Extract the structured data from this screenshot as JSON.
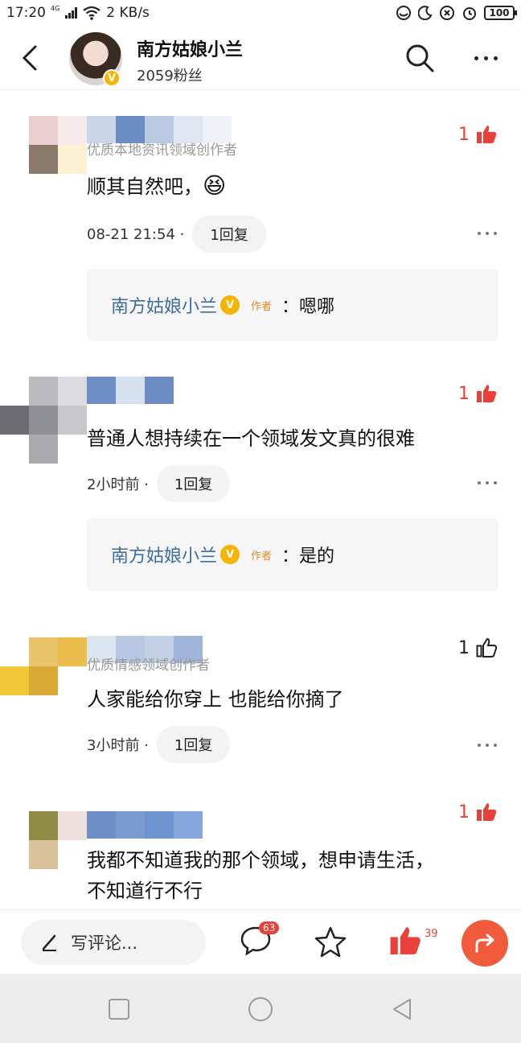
{
  "status_bar": {
    "time": "17:20",
    "network_tag": "4G",
    "speed": "2 KB/s",
    "battery": "100"
  },
  "header": {
    "name": "南方姑娘小兰",
    "fans": "2059粉丝",
    "verified_mark": "V"
  },
  "comments": [
    {
      "sub_label": "优质本地资讯领域创作者",
      "text": "顺其自然吧，",
      "emoji": "😆",
      "time": "08-21 21:54 ·",
      "reply_count": "1回复",
      "likes": "1",
      "liked": true,
      "reply": {
        "author": "南方姑娘小兰",
        "tag": "作者",
        "text": "：嗯哪"
      }
    },
    {
      "sub_label": "",
      "text": "普通人想持续在一个领域发文真的很难",
      "time": "2小时前 ·",
      "reply_count": "1回复",
      "likes": "1",
      "liked": true,
      "reply": {
        "author": "南方姑娘小兰",
        "tag": "作者",
        "text": "：是的"
      }
    },
    {
      "sub_label": "优质情感领域创作者",
      "text": "人家能给你穿上 也能给你摘了",
      "time": "3小时前 ·",
      "reply_count": "1回复",
      "likes": "1",
      "liked": false
    },
    {
      "sub_label": "",
      "text_line1": "我都不知道我的那个领域，想申请生活，",
      "text_line2": "不知道行不行",
      "likes": "1",
      "liked": true
    }
  ],
  "bottom_bar": {
    "write_placeholder": "写评论...",
    "comment_count": "63",
    "like_count": "39"
  },
  "colors": {
    "like_red": "#e8413a",
    "author_blue": "#3d6c9e",
    "verified_gold": "#f6b400",
    "share_orange": "#f25a3c"
  },
  "icons": [
    "back-icon",
    "search-icon",
    "more-icon",
    "thumb-up-icon",
    "pencil-icon",
    "comment-icon",
    "star-icon",
    "share-icon",
    "wifi-icon",
    "signal-icon",
    "alarm-icon",
    "moon-icon"
  ]
}
